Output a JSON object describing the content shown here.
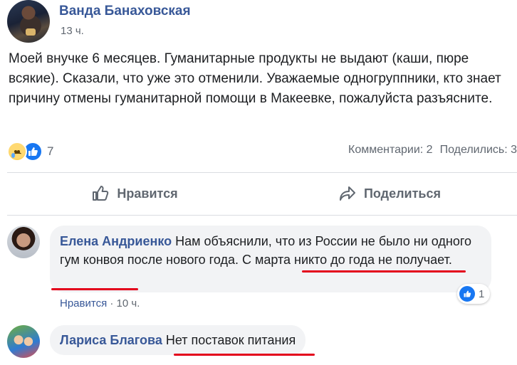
{
  "post": {
    "author": "Ванда Банаховская",
    "time": "13 ч.",
    "text": "Моей внучке 6 месяцев. Гуманитарные продукты не выдают (каши, пюре всякие). Сказали, что уже это отменили. Уважаемые одногруппники, кто знает причину отмены гуманитарной помощи в Макеевке, пожалуйста разъясните.",
    "reactions": {
      "icons": [
        "sad-reaction",
        "like-reaction"
      ],
      "count": "7"
    },
    "stats": {
      "comments": "Комментарии: 2",
      "shares": "Поделились: 3"
    }
  },
  "actions": {
    "like_label": "Нравится",
    "share_label": "Поделиться"
  },
  "comments": [
    {
      "author": "Елена Андриенко",
      "text": "Нам объяснили, что из России не было ни одного гум конвоя после нового года. С марта никто до года не получает.",
      "like_label": "Нравится",
      "separator": "·",
      "time": "10 ч.",
      "reaction_count": "1"
    },
    {
      "author": "Лариса Благова",
      "text": "Нет поставок питания"
    }
  ],
  "colors": {
    "link": "#385898",
    "annotation": "#e3001b",
    "like": "#1877f2"
  }
}
